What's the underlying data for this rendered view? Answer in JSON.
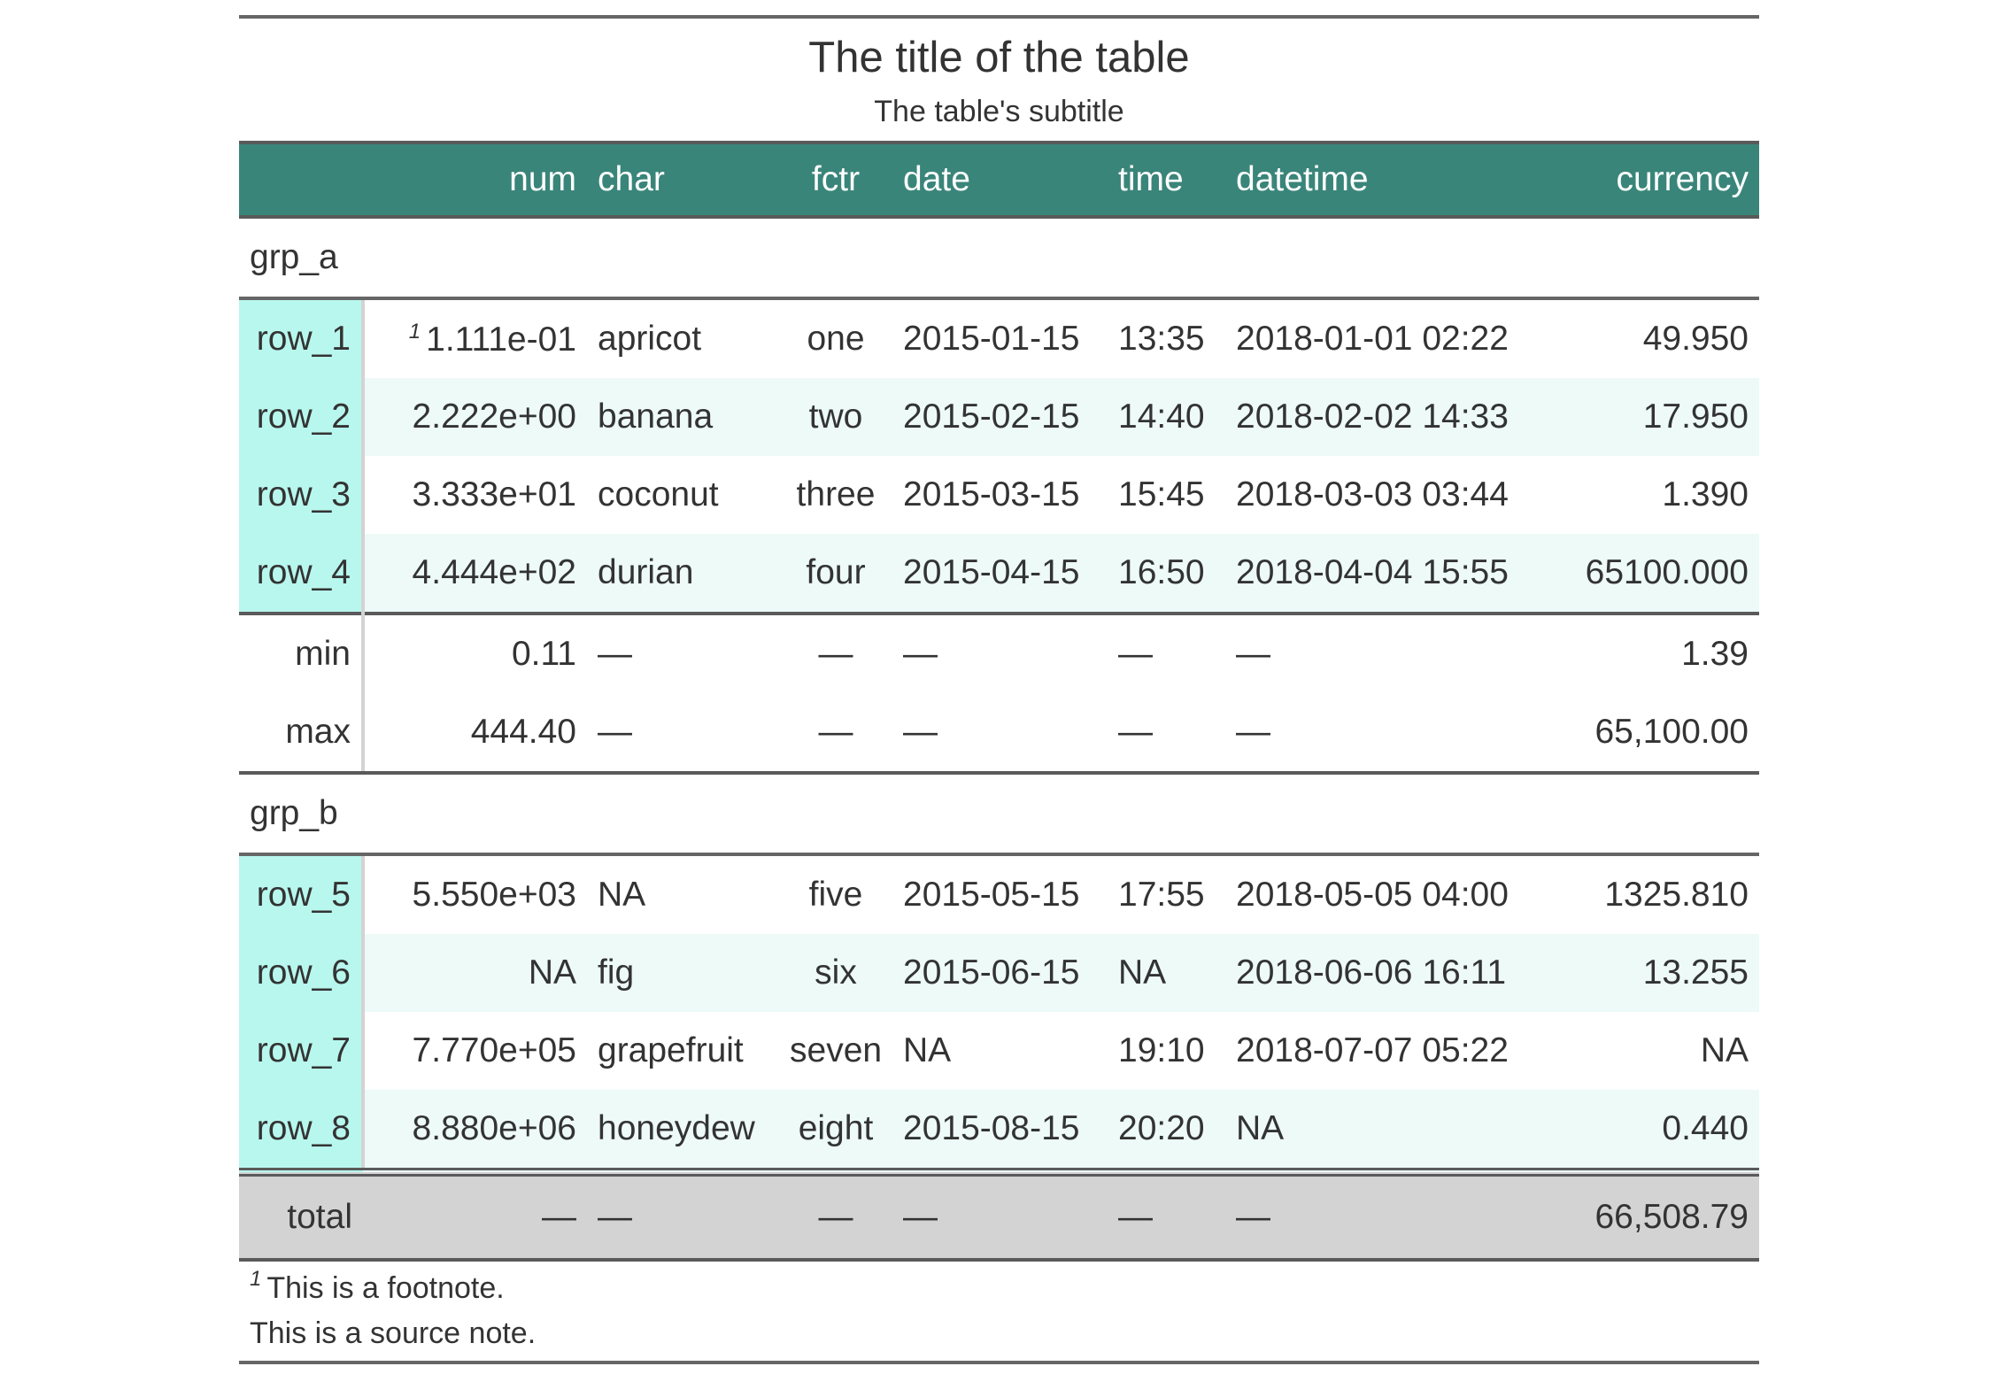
{
  "heading": {
    "title": "The title of the table",
    "subtitle": "The table's subtitle"
  },
  "columns": {
    "num": "num",
    "char": "char",
    "fctr": "fctr",
    "date": "date",
    "time": "time",
    "datetime": "datetime",
    "currency": "currency"
  },
  "groups": [
    {
      "label": "grp_a",
      "rows": [
        {
          "stub": "row_1",
          "num": "1.111e-01",
          "char": "apricot",
          "fctr": "one",
          "date": "2015-01-15",
          "time": "13:35",
          "datetime": "2018-01-01 02:22",
          "currency": "49.950"
        },
        {
          "stub": "row_2",
          "num": "2.222e+00",
          "char": "banana",
          "fctr": "two",
          "date": "2015-02-15",
          "time": "14:40",
          "datetime": "2018-02-02 14:33",
          "currency": "17.950"
        },
        {
          "stub": "row_3",
          "num": "3.333e+01",
          "char": "coconut",
          "fctr": "three",
          "date": "2015-03-15",
          "time": "15:45",
          "datetime": "2018-03-03 03:44",
          "currency": "1.390"
        },
        {
          "stub": "row_4",
          "num": "4.444e+02",
          "char": "durian",
          "fctr": "four",
          "date": "2015-04-15",
          "time": "16:50",
          "datetime": "2018-04-04 15:55",
          "currency": "65100.000"
        }
      ],
      "summary": [
        {
          "stub": "min",
          "num": "0.11",
          "char": "—",
          "fctr": "—",
          "date": "—",
          "time": "—",
          "datetime": "—",
          "currency": "1.39"
        },
        {
          "stub": "max",
          "num": "444.40",
          "char": "—",
          "fctr": "—",
          "date": "—",
          "time": "—",
          "datetime": "—",
          "currency": "65,100.00"
        }
      ]
    },
    {
      "label": "grp_b",
      "rows": [
        {
          "stub": "row_5",
          "num": "5.550e+03",
          "char": "NA",
          "fctr": "five",
          "date": "2015-05-15",
          "time": "17:55",
          "datetime": "2018-05-05 04:00",
          "currency": "1325.810"
        },
        {
          "stub": "row_6",
          "num": "NA",
          "char": "fig",
          "fctr": "six",
          "date": "2015-06-15",
          "time": "NA",
          "datetime": "2018-06-06 16:11",
          "currency": "13.255"
        },
        {
          "stub": "row_7",
          "num": "7.770e+05",
          "char": "grapefruit",
          "fctr": "seven",
          "date": "NA",
          "time": "19:10",
          "datetime": "2018-07-07 05:22",
          "currency": "NA"
        },
        {
          "stub": "row_8",
          "num": "8.880e+06",
          "char": "honeydew",
          "fctr": "eight",
          "date": "2015-08-15",
          "time": "20:20",
          "datetime": "NA",
          "currency": "0.440"
        }
      ]
    }
  ],
  "grand_summary": {
    "stub": "total",
    "num": "—",
    "char": "—",
    "fctr": "—",
    "date": "—",
    "time": "—",
    "datetime": "—",
    "currency": "66,508.79"
  },
  "footnote_mark": "1",
  "footnote": "This is a footnote.",
  "source_note": "This is a source note.",
  "colors": {
    "header_bg": "#3a857a",
    "stub_bg": "#b8f7ee",
    "stripe_bg": "#edfaf7",
    "grand_summary_bg": "#d3d3d3"
  }
}
